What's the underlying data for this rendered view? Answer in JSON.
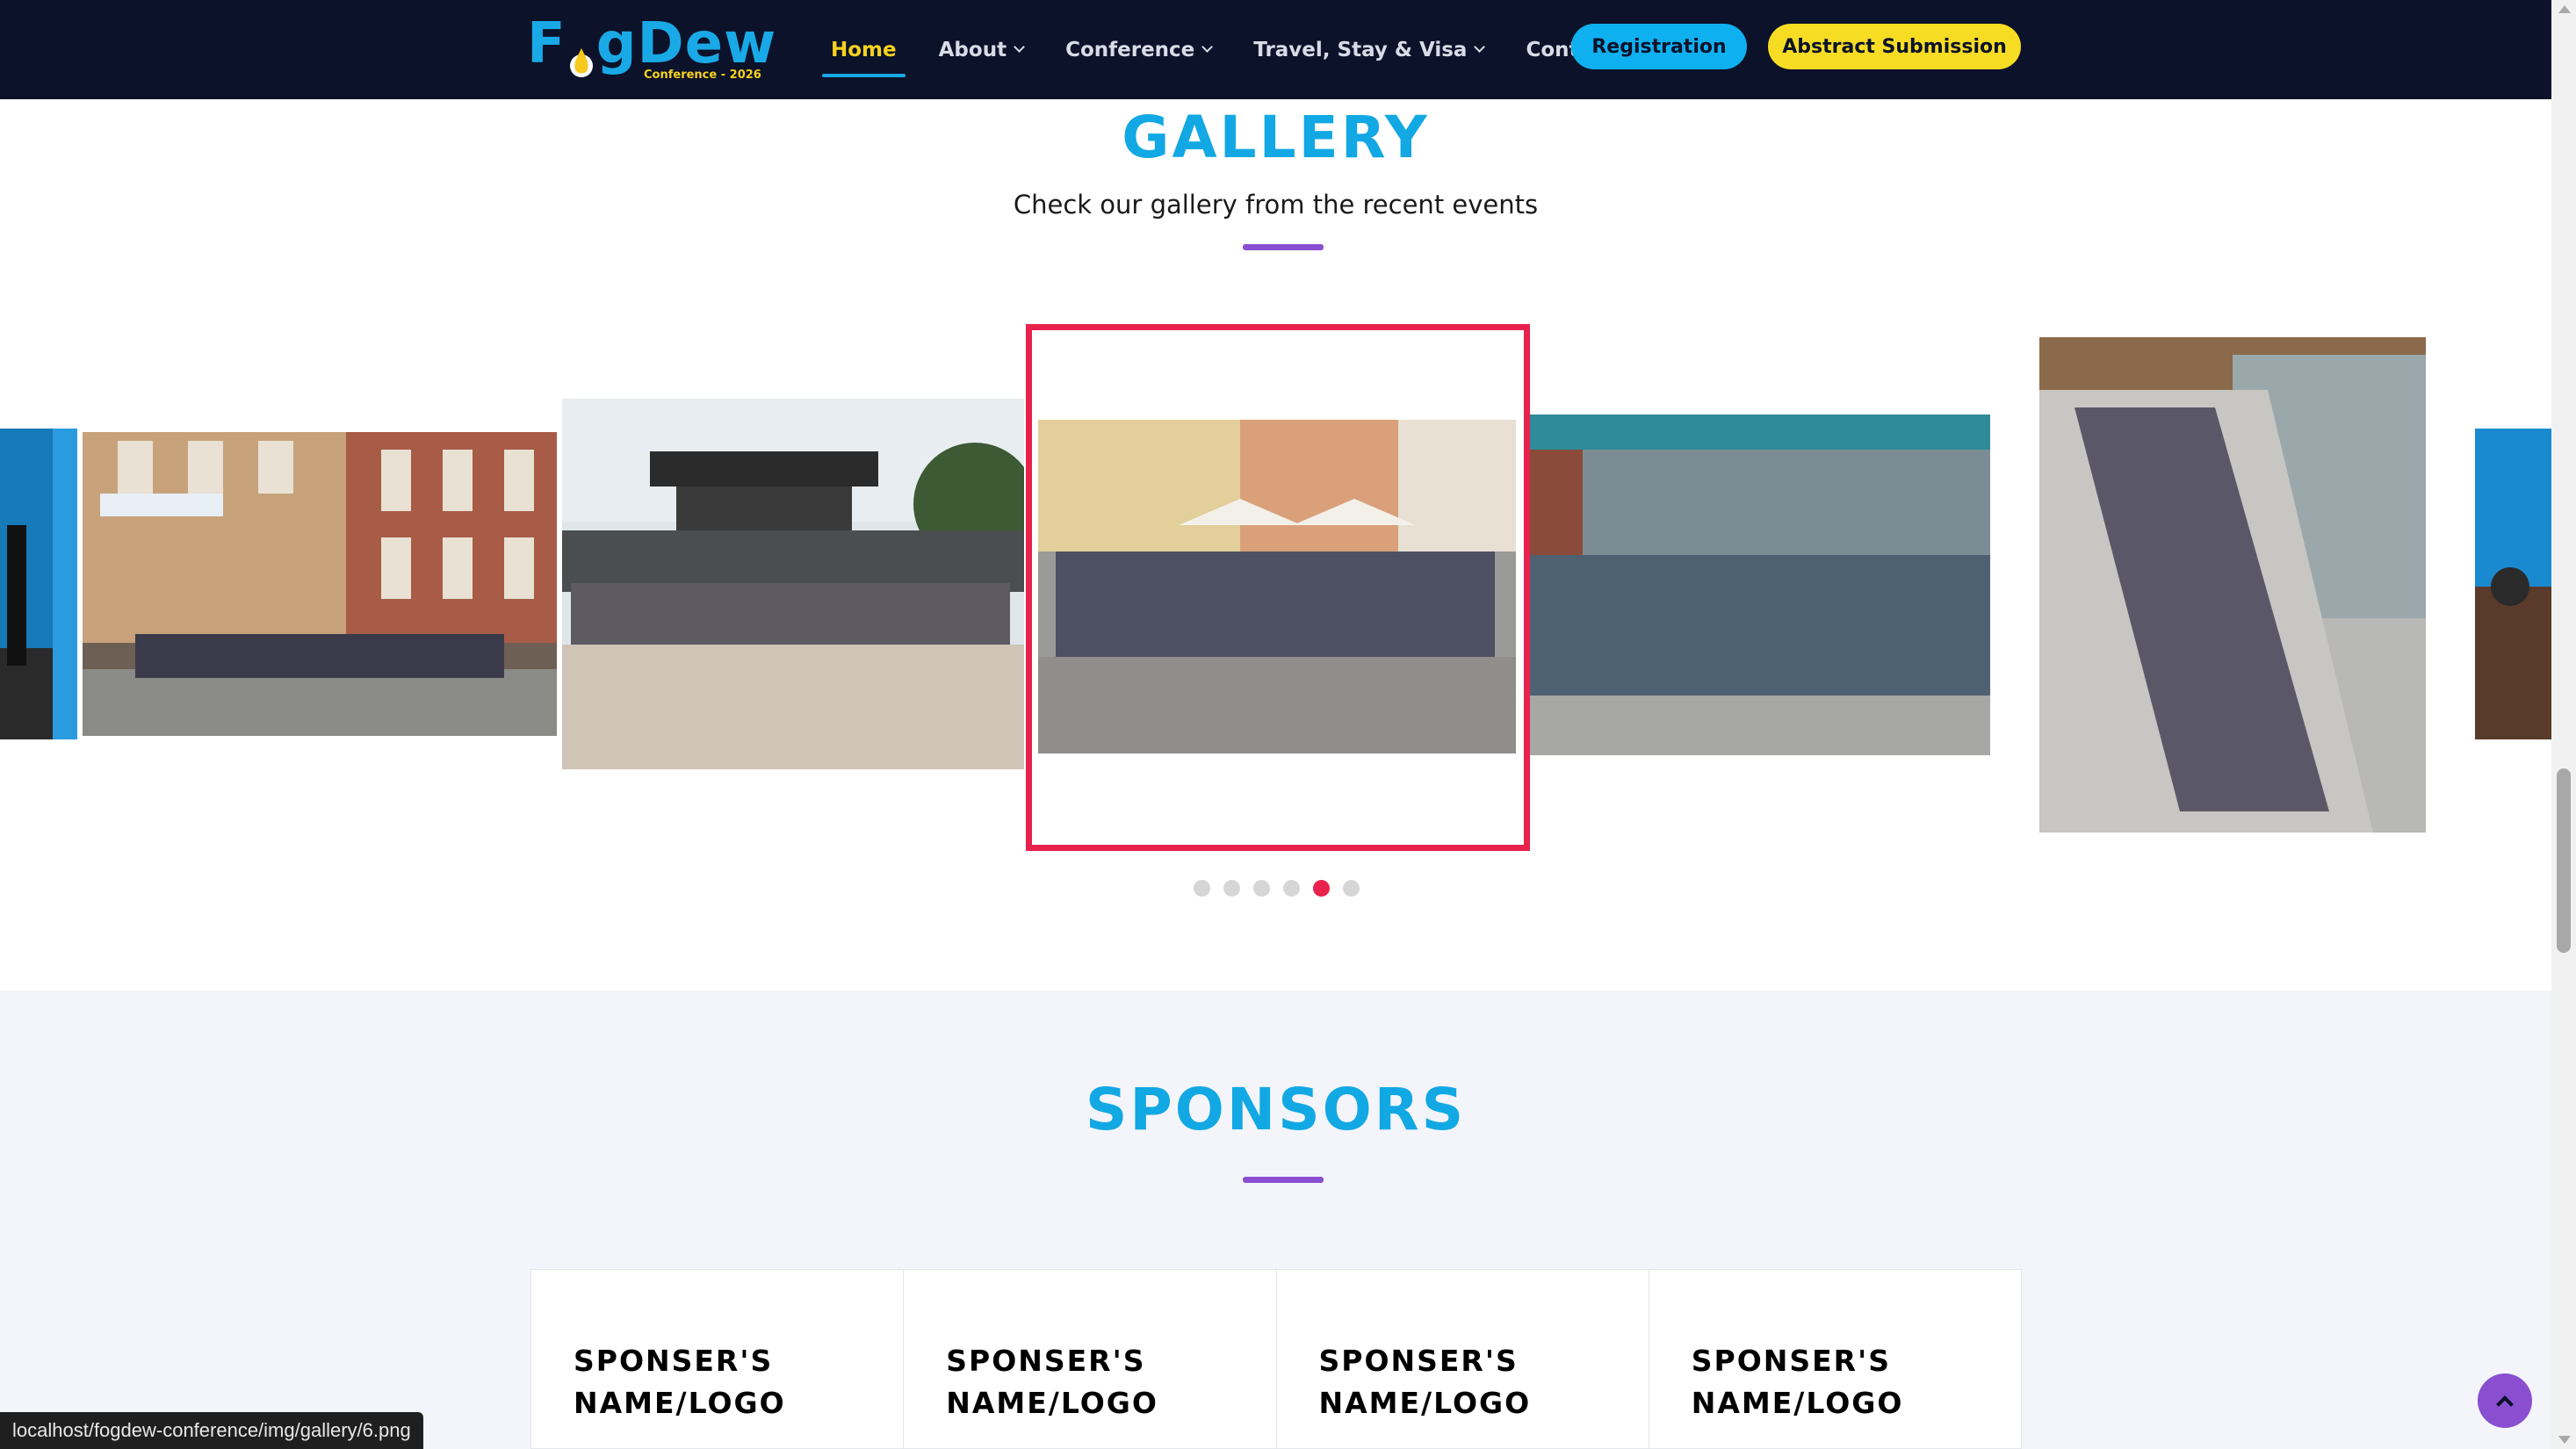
{
  "header": {
    "logo_text_a": "F",
    "logo_text_b": "gDew",
    "logo_sub": "Conference - 2026",
    "nav": [
      {
        "label": "Home",
        "active": true,
        "dropdown": false
      },
      {
        "label": "About",
        "active": false,
        "dropdown": true
      },
      {
        "label": "Conference",
        "active": false,
        "dropdown": true
      },
      {
        "label": "Travel, Stay & Visa",
        "active": false,
        "dropdown": true
      },
      {
        "label": "Contact",
        "active": false,
        "dropdown": false
      }
    ],
    "registration_label": "Registration",
    "abstract_label": "Abstract Submission"
  },
  "gallery": {
    "title": "GALLERY",
    "subtitle": "Check our gallery from the recent events",
    "active_slide": 5,
    "slide_count": 6,
    "images": [
      "conference-audience-photo",
      "group-photo-palace",
      "group-photo-gate",
      "group-photo-town-square",
      "group-photo-building",
      "group-photo-staircase",
      "conference-dinner-photo"
    ]
  },
  "sponsors": {
    "title": "SPONSORS",
    "cards": [
      {
        "line1": "SPONSER'S",
        "line2": "NAME/LOGO"
      },
      {
        "line1": "SPONSER'S",
        "line2": "NAME/LOGO"
      },
      {
        "line1": "SPONSER'S",
        "line2": "NAME/LOGO"
      },
      {
        "line1": "SPONSER'S",
        "line2": "NAME/LOGO"
      }
    ]
  },
  "status_bar": {
    "url": "localhost/fogdew-conference/img/gallery/6.png"
  },
  "colors": {
    "navy": "#0b1229",
    "blue": "#12a8e3",
    "yellow": "#f7dc24",
    "purple": "#8a4fd1",
    "red": "#e8224d"
  }
}
